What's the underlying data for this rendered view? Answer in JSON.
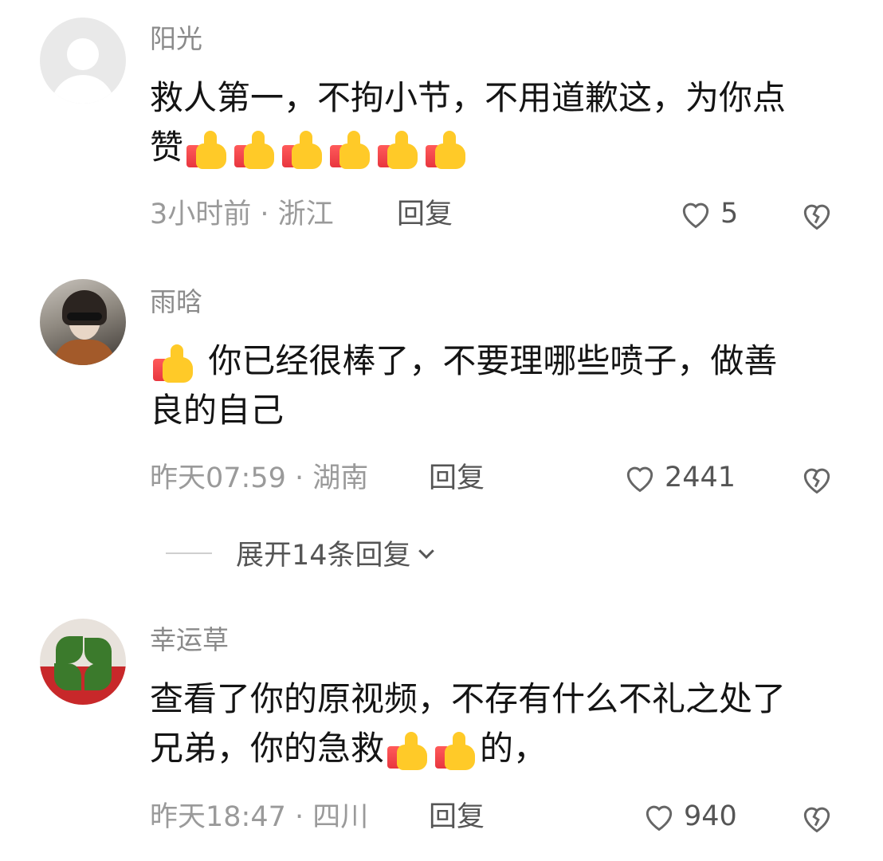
{
  "comments": [
    {
      "username": "阳光",
      "text_line1": "救人第一，不拘小节，不用道歉这，为你点",
      "text_line2": "赞",
      "time_location": "3小时前 · 浙江",
      "reply_label": "回复",
      "likes": "5",
      "avatar": "default-avatar"
    },
    {
      "username": "雨晗",
      "text_line1": "你已经很棒了，不要理哪些喷子，做善",
      "text_line2": "良的自己",
      "time_location": "昨天07:59 · 湖南",
      "reply_label": "回复",
      "likes": "2441",
      "avatar": "photo-avatar",
      "expand_label": "展开14条回复"
    },
    {
      "username": "幸运草",
      "text_line1": "查看了你的原视频，不存有什么不礼之处了",
      "text_line2a": "兄弟，你的急救",
      "text_line2b": "的，",
      "time_location": "昨天18:47 · 四川",
      "reply_label": "回复",
      "likes": "940",
      "avatar": "clover-avatar"
    }
  ],
  "icons": {
    "like": "heart-outline-icon",
    "dislike": "broken-heart-icon",
    "emoji": "thumbs-up-emoji",
    "expand": "chevron-down-icon"
  },
  "colors": {
    "text": "#141414",
    "meta": "#9a9a9a",
    "username": "#8a8a8a"
  }
}
